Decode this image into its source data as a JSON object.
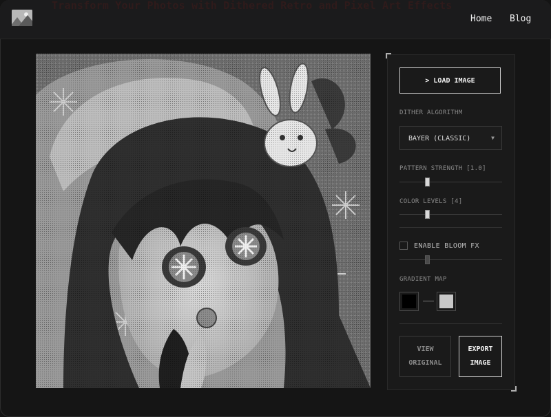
{
  "header": {
    "banner_text": "Transform Your Photos with Dithered Retro and Pixel Art Effects",
    "nav": [
      {
        "label": "Home"
      },
      {
        "label": "Blog"
      }
    ]
  },
  "preview": {
    "image_description": "dithered grayscale anime illustration"
  },
  "controls": {
    "load_button": "> LOAD IMAGE",
    "algorithm_label": "DITHER ALGORITHM",
    "algorithm_value": "BAYER (CLASSIC)",
    "pattern_strength_label": "PATTERN STRENGTH [1.0]",
    "pattern_strength_fraction": 0.26,
    "color_levels_label": "COLOR LEVELS [4]",
    "color_levels_fraction": 0.26,
    "bloom_label": "ENABLE BLOOM FX",
    "bloom_enabled": false,
    "bloom_fraction": 0.26,
    "gradient_label": "GRADIENT MAP",
    "gradient_start_color": "#000000",
    "gradient_end_color": "#c8c8c8",
    "view_original_line1": "VIEW",
    "view_original_line2": "ORIGINAL",
    "export_line1": "EXPORT",
    "export_line2": "IMAGE"
  },
  "colors": {
    "background": "#141414",
    "panel": "#1a1a1a",
    "accent": "#d0d0d0"
  },
  "icons": {
    "logo": "image-landscape-icon",
    "select_arrow": "triangle-down-icon"
  }
}
